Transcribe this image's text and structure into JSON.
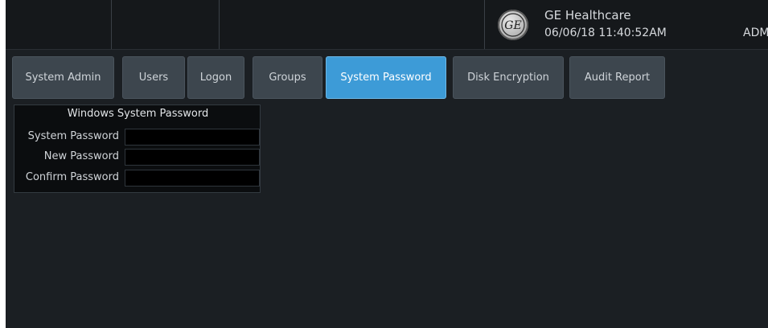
{
  "header": {
    "company": "GE Healthcare",
    "datetime": "06/06/18 11:40:52AM",
    "user": "ADM",
    "logo_icon": "ge-monogram-logo"
  },
  "tabs": [
    {
      "label": "System Admin",
      "active": false
    },
    {
      "label": "Users",
      "active": false
    },
    {
      "label": "Logon",
      "active": false
    },
    {
      "label": "Groups",
      "active": false
    },
    {
      "label": "System Password",
      "active": true
    },
    {
      "label": "Disk Encryption",
      "active": false
    },
    {
      "label": "Audit Report",
      "active": false
    }
  ],
  "password_panel": {
    "title": "Windows System Password",
    "fields": [
      {
        "label": "System Password",
        "value": ""
      },
      {
        "label": "New Password",
        "value": ""
      },
      {
        "label": "Confirm Password",
        "value": ""
      }
    ]
  },
  "colors": {
    "background": "#1b1f23",
    "tab": "#3d464e",
    "tab_active": "#3d9bd7",
    "panel": "#0b0d0f"
  }
}
